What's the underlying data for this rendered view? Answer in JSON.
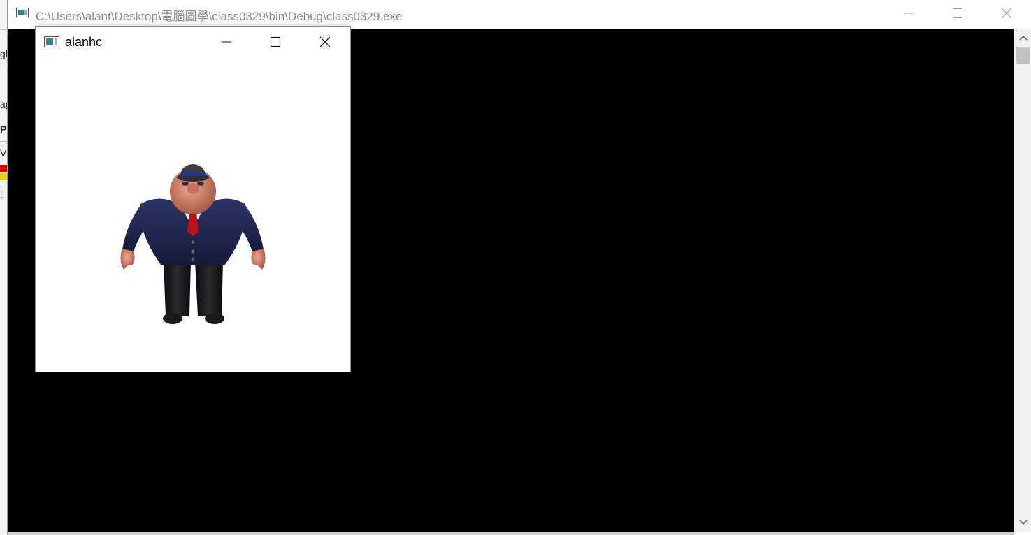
{
  "console_window": {
    "title": "C:\\Users\\alant\\Desktop\\電腦圖學\\class0329\\bin\\Debug\\class0329.exe",
    "background_color": "#000000",
    "icons": {
      "app": "console-app-icon",
      "minimize": "minimize-icon",
      "maximize": "maximize-icon",
      "close": "close-icon",
      "scroll_up": "chevron-up-icon",
      "scroll_down": "chevron-down-icon"
    }
  },
  "gl_window": {
    "title": "alanhc",
    "background_color": "#ffffff",
    "scene": "3d-character-figure",
    "icons": {
      "app": "glut-app-icon",
      "minimize": "minimize-icon",
      "maximize": "maximize-icon",
      "close": "close-icon"
    }
  },
  "background_app": {
    "fragments": [
      "gl",
      "ag",
      "P",
      "V",
      "["
    ]
  }
}
